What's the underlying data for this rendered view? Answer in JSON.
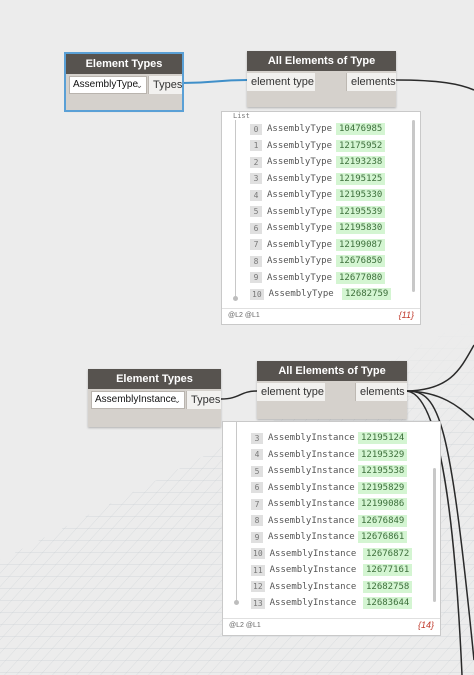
{
  "node1": {
    "title": "Element Types",
    "dropdown": "AssemblyType",
    "output": "Types"
  },
  "node2": {
    "title": "All Elements of Type",
    "input": "element type",
    "output": "elements"
  },
  "preview1": {
    "list_label": "List",
    "rows": [
      {
        "i": "0",
        "type": "AssemblyType",
        "value": "10476985"
      },
      {
        "i": "1",
        "type": "AssemblyType",
        "value": "12175952"
      },
      {
        "i": "2",
        "type": "AssemblyType",
        "value": "12193238"
      },
      {
        "i": "3",
        "type": "AssemblyType",
        "value": "12195125"
      },
      {
        "i": "4",
        "type": "AssemblyType",
        "value": "12195330"
      },
      {
        "i": "5",
        "type": "AssemblyType",
        "value": "12195539"
      },
      {
        "i": "6",
        "type": "AssemblyType",
        "value": "12195830"
      },
      {
        "i": "7",
        "type": "AssemblyType",
        "value": "12199087"
      },
      {
        "i": "8",
        "type": "AssemblyType",
        "value": "12676850"
      },
      {
        "i": "9",
        "type": "AssemblyType",
        "value": "12677080"
      },
      {
        "i": "10",
        "type": "AssemblyType",
        "value": "12682759"
      }
    ],
    "levels": "@L2 @L1",
    "count": "{11}"
  },
  "node3": {
    "title": "Element Types",
    "dropdown": "AssemblyInstance",
    "output": "Types"
  },
  "node4": {
    "title": "All Elements of Type",
    "input": "element type",
    "output": "elements"
  },
  "preview2": {
    "rows": [
      {
        "i": "3",
        "type": "AssemblyInstance",
        "value": "12195124"
      },
      {
        "i": "4",
        "type": "AssemblyInstance",
        "value": "12195329"
      },
      {
        "i": "5",
        "type": "AssemblyInstance",
        "value": "12195538"
      },
      {
        "i": "6",
        "type": "AssemblyInstance",
        "value": "12195829"
      },
      {
        "i": "7",
        "type": "AssemblyInstance",
        "value": "12199086"
      },
      {
        "i": "8",
        "type": "AssemblyInstance",
        "value": "12676849"
      },
      {
        "i": "9",
        "type": "AssemblyInstance",
        "value": "12676861"
      },
      {
        "i": "10",
        "type": "AssemblyInstance",
        "value": "12676872"
      },
      {
        "i": "11",
        "type": "AssemblyInstance",
        "value": "12677161"
      },
      {
        "i": "12",
        "type": "AssemblyInstance",
        "value": "12682758"
      },
      {
        "i": "13",
        "type": "AssemblyInstance",
        "value": "12683644"
      }
    ],
    "levels": "@L2 @L1",
    "count": "{14}"
  },
  "colors": {
    "node_header": "#57534f",
    "node_body": "#d5d1cc",
    "selected_outline": "#5aa0d6",
    "wire": "#2a2a2a",
    "wire_selected": "#3f8fc9",
    "value_bg": "#d4f5d2",
    "count_color": "#c0392b"
  }
}
